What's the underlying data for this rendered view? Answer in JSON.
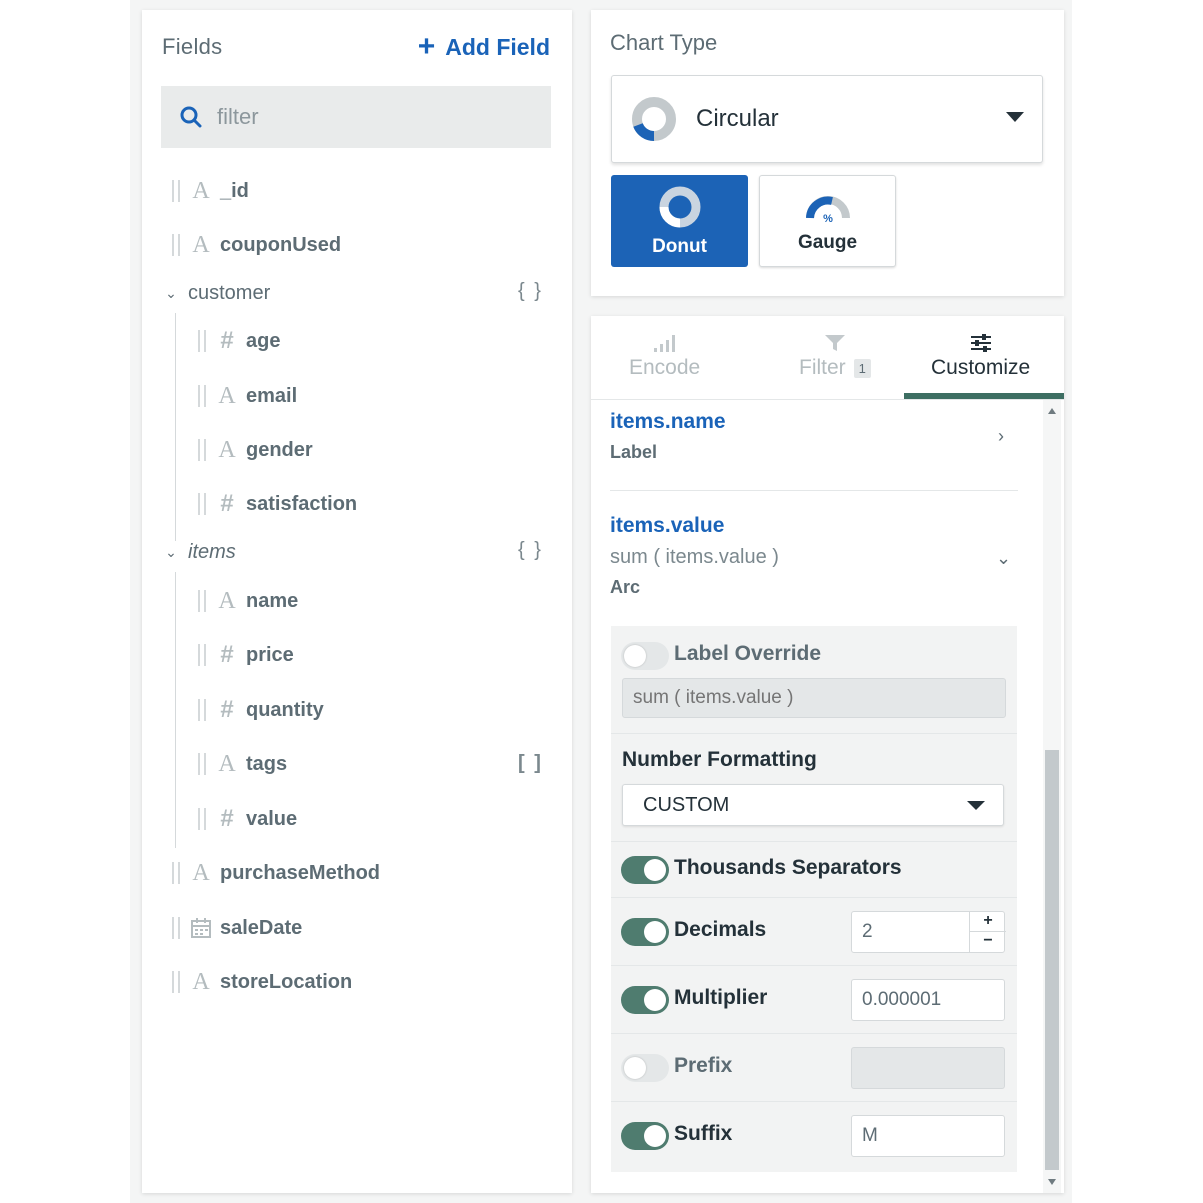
{
  "fields_panel": {
    "title": "Fields",
    "add_field_label": "Add Field",
    "search_placeholder": "filter",
    "fields": [
      {
        "name": "_id",
        "type": "string"
      },
      {
        "name": "couponUsed",
        "type": "string"
      },
      {
        "name": "customer",
        "type": "object",
        "marker": "{ }"
      },
      {
        "name": "age",
        "type": "number"
      },
      {
        "name": "email",
        "type": "string"
      },
      {
        "name": "gender",
        "type": "string"
      },
      {
        "name": "satisfaction",
        "type": "number"
      },
      {
        "name": "items",
        "type": "array-object",
        "marker": "{ }"
      },
      {
        "name": "name",
        "type": "string"
      },
      {
        "name": "price",
        "type": "number"
      },
      {
        "name": "quantity",
        "type": "number"
      },
      {
        "name": "tags",
        "type": "string",
        "marker": "[ ]"
      },
      {
        "name": "value",
        "type": "number"
      },
      {
        "name": "purchaseMethod",
        "type": "string"
      },
      {
        "name": "saleDate",
        "type": "date"
      },
      {
        "name": "storeLocation",
        "type": "string"
      }
    ]
  },
  "chart_type": {
    "title": "Chart Type",
    "selected": "Circular",
    "subtypes": [
      {
        "label": "Donut",
        "active": true
      },
      {
        "label": "Gauge",
        "active": false
      }
    ]
  },
  "tabs": [
    {
      "label": "Encode",
      "active": false
    },
    {
      "label": "Filter",
      "badge": "1",
      "active": false
    },
    {
      "label": "Customize",
      "active": true
    }
  ],
  "encodings": [
    {
      "field": "items.name",
      "role": "Label",
      "expanded": false
    },
    {
      "field": "items.value",
      "aggregate": "sum ( items.value )",
      "role": "Arc",
      "expanded": true
    }
  ],
  "options": {
    "label_override": {
      "label": "Label Override",
      "enabled": false,
      "placeholder": "sum ( items.value )"
    },
    "number_formatting": {
      "label": "Number Formatting",
      "value": "CUSTOM"
    },
    "thousands_separators": {
      "label": "Thousands Separators",
      "enabled": true
    },
    "decimals": {
      "label": "Decimals",
      "enabled": true,
      "value": "2"
    },
    "multiplier": {
      "label": "Multiplier",
      "enabled": true,
      "value": "0.000001"
    },
    "prefix": {
      "label": "Prefix",
      "enabled": false,
      "value": ""
    },
    "suffix": {
      "label": "Suffix",
      "enabled": true,
      "value": "M"
    }
  },
  "colors": {
    "accent_blue": "#1c63b6",
    "toggle_on": "#4f7c6f",
    "active_tab": "#3d6e62"
  }
}
